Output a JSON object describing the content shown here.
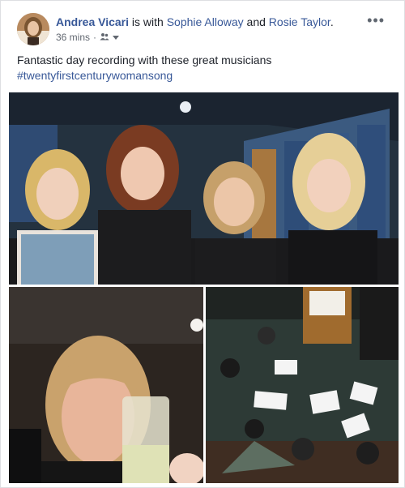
{
  "post": {
    "author": "Andrea Vicari",
    "with_text": " is with ",
    "tagged_1": "Sophie Alloway",
    "and_text": " and ",
    "tagged_2": "Rosie Taylor",
    "period": ".",
    "timestamp": "36 mins",
    "separator": "·",
    "audience_icon": "friends-icon",
    "more_label": "•••",
    "text": "Fantastic day recording with these great musicians",
    "hashtag": "#twentyfirstcenturywomansong"
  },
  "colors": {
    "link": "#385898",
    "text": "#1d2129",
    "meta": "#616770"
  }
}
